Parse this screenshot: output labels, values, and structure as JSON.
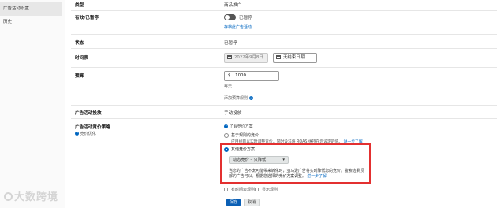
{
  "sidebar": {
    "items": [
      {
        "label": "广告活动设置"
      },
      {
        "label": "历史"
      }
    ]
  },
  "rows": {
    "type": {
      "label": "类型",
      "value": "商品推广"
    },
    "active": {
      "label": "有效/已暂停",
      "toggle_text": "已暂停",
      "archive_link": "存档此广告活动"
    },
    "status": {
      "label": "状态",
      "value": "已暂停"
    },
    "schedule": {
      "label": "时间表",
      "start_date": "2022年9月8日",
      "end_placeholder": "无结束日期"
    },
    "budget": {
      "label": "预算",
      "currency": "$",
      "amount": "1000",
      "period": "每天",
      "rule_link": "添加预算规则"
    },
    "placement": {
      "label": "广告活动投放",
      "value": "手动投放"
    },
    "bidding": {
      "label": "广告活动竞价策略",
      "help_link": "竞价优化",
      "learn_link": "了解竞价方案",
      "option1_title": "基于规则的竞价",
      "option1_desc": "应用规则以实时调整竞价。同时设法将 ROAS 维持在您设定的值。",
      "option1_more": "进一步了解",
      "option2_title": "其他竞价方案",
      "option2_dropdown": "动态竞价 – 只降低",
      "option2_desc": "当您的广告不太可能带来转化时，亚马逊广告将实时降低您的竞价。搜索结果顶部的广告可以。根据您选择的竞价方案调整。",
      "option2_more": "进一步了解"
    },
    "schedule_rule": {
      "checkbox_label": "有时间表规则",
      "show_rule_link": "显示规则"
    }
  },
  "buttons": {
    "save": "保存",
    "cancel": "取消"
  },
  "watermark": "大数跨境",
  "colors": {
    "accent": "#0066c0",
    "highlight_border": "#e33030",
    "save_button": "#0a5fb5"
  }
}
